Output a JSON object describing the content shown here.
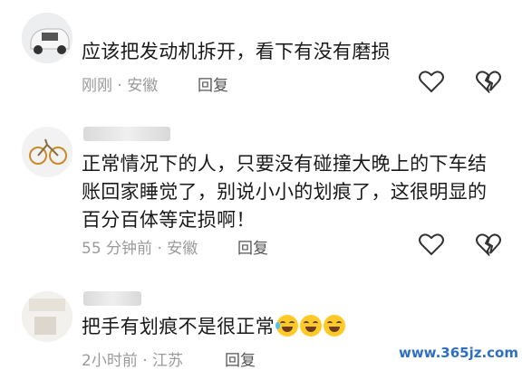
{
  "comments": [
    {
      "text": "应该把发动机拆开，看下有没有磨损",
      "meta": "刚刚 · 安徽",
      "reply": "回复"
    },
    {
      "text": "正常情况下的人，只要没有碰撞大晚上的下车结账回家睡觉了，别说小小的划痕了，这很明显的百分百体等定损啊！",
      "meta": "55 分钟前 · 安徽",
      "reply": "回复"
    },
    {
      "text": "把手有划痕不是很正常",
      "meta": "2小时前 · 江苏",
      "reply": "回复"
    }
  ],
  "icons": {
    "like": "heart-icon",
    "dislike": "broken-heart-icon",
    "emoji": "laughing-crying-emoji"
  },
  "watermark": "www.365jz.com",
  "colors": {
    "text": "#1a1a1a",
    "meta": "#9a9a9a",
    "watermark": "#2f6fc0"
  }
}
